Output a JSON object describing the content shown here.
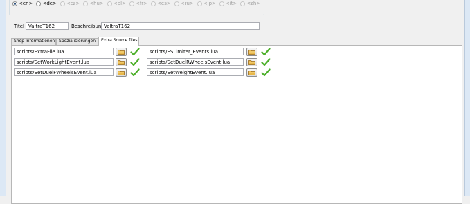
{
  "languages": [
    {
      "code": "<en>",
      "checked": true,
      "enabled": true
    },
    {
      "code": "<de>",
      "checked": false,
      "enabled": true
    },
    {
      "code": "<cz>",
      "checked": false,
      "enabled": false
    },
    {
      "code": "<hu>",
      "checked": false,
      "enabled": false
    },
    {
      "code": "<pl>",
      "checked": false,
      "enabled": false
    },
    {
      "code": "<fr>",
      "checked": false,
      "enabled": false
    },
    {
      "code": "<es>",
      "checked": false,
      "enabled": false
    },
    {
      "code": "<ru>",
      "checked": false,
      "enabled": false
    },
    {
      "code": "<jp>",
      "checked": false,
      "enabled": false
    },
    {
      "code": "<it>",
      "checked": false,
      "enabled": false
    },
    {
      "code": "<zh>",
      "checked": false,
      "enabled": false
    }
  ],
  "fields": {
    "title_label": "Titel",
    "title_value": "ValtraT162",
    "description_label": "Beschreibung",
    "description_value": "ValtraT162"
  },
  "tabs": [
    {
      "label": "Shop Informationen",
      "active": false
    },
    {
      "label": "Spezialisierungen",
      "active": false
    },
    {
      "label": "Extra Source files",
      "active": true
    }
  ],
  "source_files": [
    "scripts/ExtraFile.lua",
    "scripts/ESLimiter_Events.lua",
    "scripts/SetWorkLightEvent.lua",
    "scripts/SetDuelRWheelsEvent.lua",
    "scripts/SetDuelFWheelsEvent.lua",
    "scripts/SetWeightEvent.lua"
  ],
  "colors": {
    "check_green": "#4caf2a",
    "folder_yellow": "#e8b84a"
  },
  "icons": {
    "browse": "folder-icon",
    "status": "checkmark-icon"
  }
}
